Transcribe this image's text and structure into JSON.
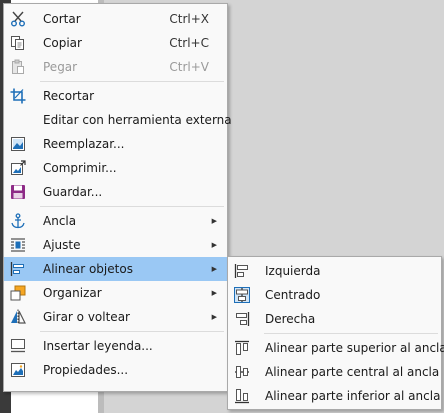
{
  "main_menu": {
    "group1": [
      {
        "label": "Cortar",
        "shortcut": "Ctrl+X",
        "icon": "scissors-icon"
      },
      {
        "label": "Copiar",
        "shortcut": "Ctrl+C",
        "icon": "copy-icon"
      },
      {
        "label": "Pegar",
        "shortcut": "Ctrl+V",
        "icon": "paste-icon",
        "disabled": true
      }
    ],
    "group2": [
      {
        "label": "Recortar",
        "icon": "crop-icon"
      },
      {
        "label": "Editar con herramienta externa"
      },
      {
        "label": "Reemplazar...",
        "icon": "replace-image-icon"
      },
      {
        "label": "Comprimir...",
        "icon": "compress-image-icon"
      },
      {
        "label": "Guardar...",
        "icon": "save-icon"
      }
    ],
    "group3": [
      {
        "label": "Ancla",
        "icon": "anchor-icon",
        "submenu": true
      },
      {
        "label": "Ajuste",
        "icon": "wrap-icon",
        "submenu": true
      },
      {
        "label": "Alinear objetos",
        "icon": "align-icon",
        "submenu": true,
        "highlighted": true
      },
      {
        "label": "Organizar",
        "icon": "arrange-icon",
        "submenu": true
      },
      {
        "label": "Girar o voltear",
        "icon": "flip-icon",
        "submenu": true
      }
    ],
    "group4": [
      {
        "label": "Insertar leyenda...",
        "icon": "caption-icon"
      },
      {
        "label": "Propiedades...",
        "icon": "properties-icon"
      }
    ]
  },
  "submenu": {
    "group1": [
      {
        "label": "Izquierda",
        "icon": "align-left-icon"
      },
      {
        "label": "Centrado",
        "icon": "align-center-icon",
        "active": true
      },
      {
        "label": "Derecha",
        "icon": "align-right-icon"
      }
    ],
    "group2": [
      {
        "label": "Alinear parte superior al ancla",
        "icon": "align-top-icon"
      },
      {
        "label": "Alinear parte central al ancla",
        "icon": "align-middle-icon"
      },
      {
        "label": "Alinear parte inferior al ancla",
        "icon": "align-bottom-icon"
      }
    ]
  },
  "colors": {
    "highlight": "#9ac8f4",
    "menu_bg": "#f9f9f9",
    "icon_blue": "#1e6fb8",
    "icon_purple": "#8e2b87"
  }
}
